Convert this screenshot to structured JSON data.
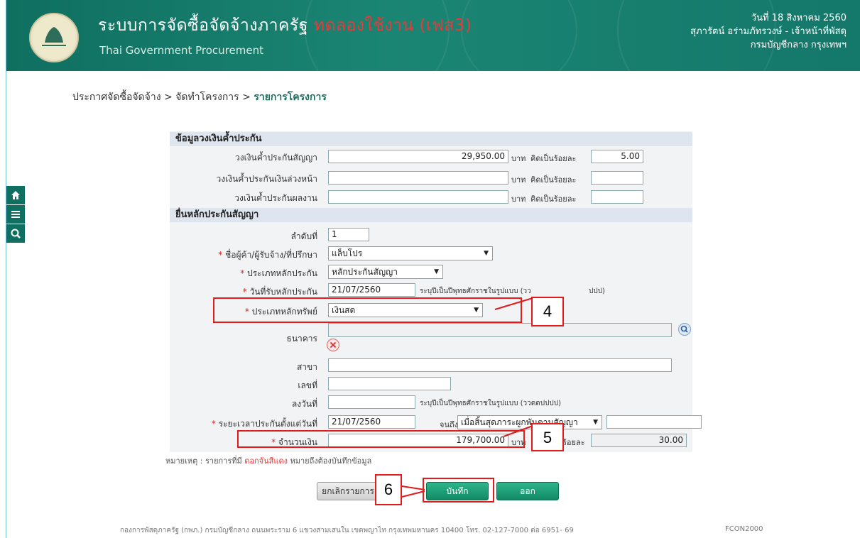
{
  "header": {
    "title": "ระบบการจัดซื้อจัดจ้างภาครัฐ",
    "trial": "ทดลองใช้งาน (เฟส3)",
    "subtitle": "Thai Government Procurement",
    "date": "วันที่ 18 สิงหาคม 2560",
    "user": "สุภารัตน์ อร่ามภัทรวงษ์ - เจ้าหน้าที่พัสดุ",
    "org": "กรมบัญชีกลาง กรุงเทพฯ"
  },
  "breadcrumb": {
    "item1": "ประกาศจัดซื้อจัดจ้าง",
    "sep1": ">",
    "item2": "จัดทำโครงการ",
    "sep2": ">",
    "item3": "รายการโครงการ"
  },
  "sidebar": [
    "home-icon",
    "menu-icon",
    "search-icon"
  ],
  "guarantee_budget": {
    "section": "ข้อมูลวงเงินค้ำประกัน",
    "rows": [
      {
        "label": "วงเงินค้ำประกันสัญญา",
        "amount": "29,950.00",
        "unit": "บาท",
        "percent_label": "คิดเป็นร้อยละ",
        "percent": "5.00"
      },
      {
        "label": "วงเงินค้ำประกันเงินล่วงหน้า",
        "amount": "",
        "unit": "บาท",
        "percent_label": "คิดเป็นร้อยละ",
        "percent": ""
      },
      {
        "label": "วงเงินค้ำประกันผลงาน",
        "amount": "",
        "unit": "บาท",
        "percent_label": "คิดเป็นร้อยละ",
        "percent": ""
      }
    ]
  },
  "contract_guarantee": {
    "section": "ยื่นหลักประกันสัญญา",
    "seq_label": "ลำดับที่",
    "seq": "1",
    "vendor_label": "ชื่อผู้ค้า/ผู้รับจ้าง/ที่ปรึกษา",
    "vendor": "แล็บโปร",
    "type_label": "ประเภทหลักประกัน",
    "type": "หลักประกันสัญญา",
    "recv_date_label": "วันที่รับหลักประกัน",
    "recv_date": "21/07/2560",
    "recv_date_hint": "ระบุปีเป็นปีพุทธศักราชในรูปแบบ (วว",
    "recv_date_hint_tail": "ปปป)",
    "asset_label": "ประเภทหลักทรัพย์",
    "asset": "เงินสด",
    "bank_label": "ธนาคาร",
    "branch_label": "สาขา",
    "number_label": "เลขที่",
    "date_label": "ลงวันที่",
    "date_hint": "ระบุปีเป็นปีพุทธศักราชในรูปแบบ (ววดดปปปป)",
    "period_label": "ระยะเวลาประกันตั้งแต่วันที่",
    "period_start": "21/07/2560",
    "until_label": "จนถึง",
    "until": "เมื่อสิ้นสุดภาระผูกพันตามสัญญา",
    "amount_label": "จำนวนเงิน",
    "amount": "179,700.00",
    "amount_unit": "บาท",
    "amount_pct_label": "ร้อยละ",
    "amount_pct": "30.00"
  },
  "note": {
    "prefix": "หมายเหตุ : รายการที่มี",
    "red": "ดอกจันสีแดง",
    "suffix": "หมายถึงต้องบันทึกข้อมูล"
  },
  "buttons": {
    "cancel": "ยกเลิกรายการ",
    "save": "บันทึก",
    "exit": "ออก"
  },
  "callouts": {
    "four": "4",
    "five": "5",
    "six": "6"
  },
  "footer": {
    "address": "กองการพัสดุภาครัฐ (กพภ.) กรมบัญชีกลาง ถนนพระราม 6 แขวงสามเสนใน เขตพญาไท กรุงเทพมหานคร 10400 โทร. 02-127-7000 ต่อ 6951- 69",
    "code": "FCON2000"
  }
}
